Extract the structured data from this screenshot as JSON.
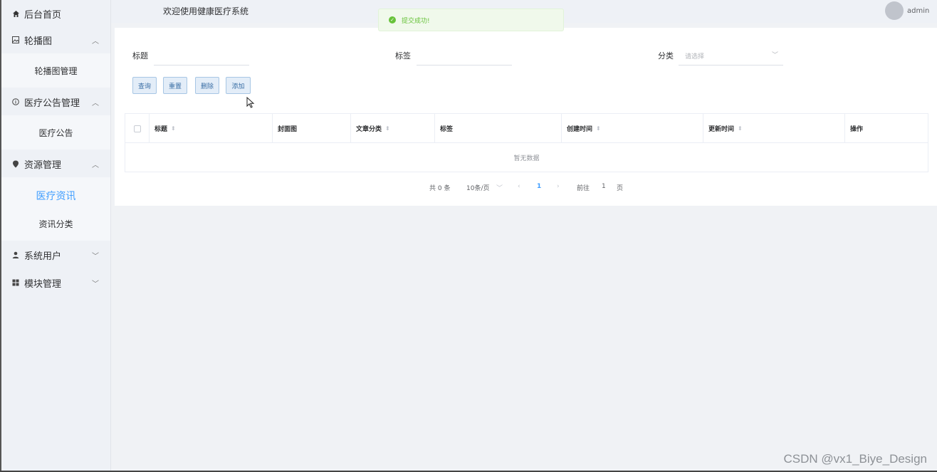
{
  "header": {
    "title": "欢迎使用健康医疗系统",
    "username": "admin"
  },
  "toast": {
    "message": "提交成功!"
  },
  "sidebar": {
    "home": "后台首页",
    "groups": [
      {
        "label": "轮播图",
        "icon": "image-icon",
        "expanded": true,
        "items": [
          "轮播图管理"
        ]
      },
      {
        "label": "医疗公告管理",
        "icon": "info-icon",
        "expanded": true,
        "items": [
          "医疗公告"
        ]
      },
      {
        "label": "资源管理",
        "icon": "location-icon",
        "expanded": true,
        "items": [
          "医疗资讯",
          "资讯分类"
        ],
        "active": "医疗资讯"
      },
      {
        "label": "系统用户",
        "icon": "user-icon",
        "expanded": false,
        "items": []
      },
      {
        "label": "模块管理",
        "icon": "grid-icon",
        "expanded": false,
        "items": []
      }
    ]
  },
  "filters": {
    "title_label": "标题",
    "title_value": "",
    "tag_label": "标签",
    "tag_value": "",
    "category_label": "分类",
    "category_placeholder": "请选择"
  },
  "buttons": {
    "search": "查询",
    "reset": "重置",
    "delete": "删除",
    "add": "添加"
  },
  "table": {
    "columns": [
      "标题",
      "封面图",
      "文章分类",
      "标签",
      "创建时间",
      "更新时间",
      "操作"
    ],
    "empty_text": "暂无数据"
  },
  "pagination": {
    "total_text": "共 0 条",
    "page_size": "10条/页",
    "current_page": "1",
    "goto_label": "前往",
    "goto_value": "1",
    "page_suffix": "页"
  },
  "watermark": "CSDN @vx1_Biye_Design"
}
